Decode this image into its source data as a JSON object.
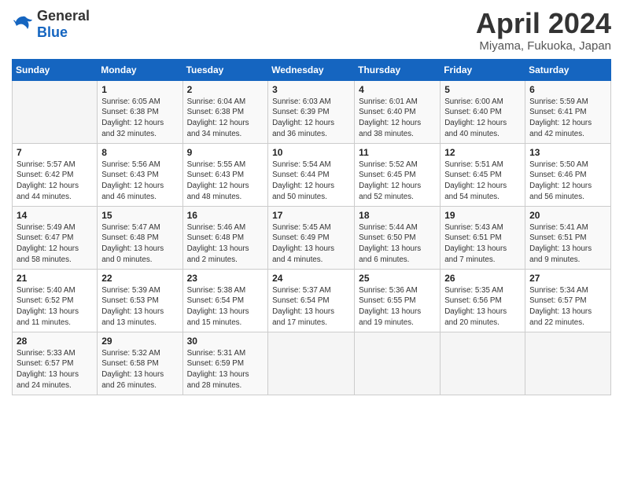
{
  "header": {
    "logo_general": "General",
    "logo_blue": "Blue",
    "title": "April 2024",
    "location": "Miyama, Fukuoka, Japan"
  },
  "calendar": {
    "days_of_week": [
      "Sunday",
      "Monday",
      "Tuesday",
      "Wednesday",
      "Thursday",
      "Friday",
      "Saturday"
    ],
    "weeks": [
      [
        {
          "day": "",
          "info": ""
        },
        {
          "day": "1",
          "info": "Sunrise: 6:05 AM\nSunset: 6:38 PM\nDaylight: 12 hours\nand 32 minutes."
        },
        {
          "day": "2",
          "info": "Sunrise: 6:04 AM\nSunset: 6:38 PM\nDaylight: 12 hours\nand 34 minutes."
        },
        {
          "day": "3",
          "info": "Sunrise: 6:03 AM\nSunset: 6:39 PM\nDaylight: 12 hours\nand 36 minutes."
        },
        {
          "day": "4",
          "info": "Sunrise: 6:01 AM\nSunset: 6:40 PM\nDaylight: 12 hours\nand 38 minutes."
        },
        {
          "day": "5",
          "info": "Sunrise: 6:00 AM\nSunset: 6:40 PM\nDaylight: 12 hours\nand 40 minutes."
        },
        {
          "day": "6",
          "info": "Sunrise: 5:59 AM\nSunset: 6:41 PM\nDaylight: 12 hours\nand 42 minutes."
        }
      ],
      [
        {
          "day": "7",
          "info": "Sunrise: 5:57 AM\nSunset: 6:42 PM\nDaylight: 12 hours\nand 44 minutes."
        },
        {
          "day": "8",
          "info": "Sunrise: 5:56 AM\nSunset: 6:43 PM\nDaylight: 12 hours\nand 46 minutes."
        },
        {
          "day": "9",
          "info": "Sunrise: 5:55 AM\nSunset: 6:43 PM\nDaylight: 12 hours\nand 48 minutes."
        },
        {
          "day": "10",
          "info": "Sunrise: 5:54 AM\nSunset: 6:44 PM\nDaylight: 12 hours\nand 50 minutes."
        },
        {
          "day": "11",
          "info": "Sunrise: 5:52 AM\nSunset: 6:45 PM\nDaylight: 12 hours\nand 52 minutes."
        },
        {
          "day": "12",
          "info": "Sunrise: 5:51 AM\nSunset: 6:45 PM\nDaylight: 12 hours\nand 54 minutes."
        },
        {
          "day": "13",
          "info": "Sunrise: 5:50 AM\nSunset: 6:46 PM\nDaylight: 12 hours\nand 56 minutes."
        }
      ],
      [
        {
          "day": "14",
          "info": "Sunrise: 5:49 AM\nSunset: 6:47 PM\nDaylight: 12 hours\nand 58 minutes."
        },
        {
          "day": "15",
          "info": "Sunrise: 5:47 AM\nSunset: 6:48 PM\nDaylight: 13 hours\nand 0 minutes."
        },
        {
          "day": "16",
          "info": "Sunrise: 5:46 AM\nSunset: 6:48 PM\nDaylight: 13 hours\nand 2 minutes."
        },
        {
          "day": "17",
          "info": "Sunrise: 5:45 AM\nSunset: 6:49 PM\nDaylight: 13 hours\nand 4 minutes."
        },
        {
          "day": "18",
          "info": "Sunrise: 5:44 AM\nSunset: 6:50 PM\nDaylight: 13 hours\nand 6 minutes."
        },
        {
          "day": "19",
          "info": "Sunrise: 5:43 AM\nSunset: 6:51 PM\nDaylight: 13 hours\nand 7 minutes."
        },
        {
          "day": "20",
          "info": "Sunrise: 5:41 AM\nSunset: 6:51 PM\nDaylight: 13 hours\nand 9 minutes."
        }
      ],
      [
        {
          "day": "21",
          "info": "Sunrise: 5:40 AM\nSunset: 6:52 PM\nDaylight: 13 hours\nand 11 minutes."
        },
        {
          "day": "22",
          "info": "Sunrise: 5:39 AM\nSunset: 6:53 PM\nDaylight: 13 hours\nand 13 minutes."
        },
        {
          "day": "23",
          "info": "Sunrise: 5:38 AM\nSunset: 6:54 PM\nDaylight: 13 hours\nand 15 minutes."
        },
        {
          "day": "24",
          "info": "Sunrise: 5:37 AM\nSunset: 6:54 PM\nDaylight: 13 hours\nand 17 minutes."
        },
        {
          "day": "25",
          "info": "Sunrise: 5:36 AM\nSunset: 6:55 PM\nDaylight: 13 hours\nand 19 minutes."
        },
        {
          "day": "26",
          "info": "Sunrise: 5:35 AM\nSunset: 6:56 PM\nDaylight: 13 hours\nand 20 minutes."
        },
        {
          "day": "27",
          "info": "Sunrise: 5:34 AM\nSunset: 6:57 PM\nDaylight: 13 hours\nand 22 minutes."
        }
      ],
      [
        {
          "day": "28",
          "info": "Sunrise: 5:33 AM\nSunset: 6:57 PM\nDaylight: 13 hours\nand 24 minutes."
        },
        {
          "day": "29",
          "info": "Sunrise: 5:32 AM\nSunset: 6:58 PM\nDaylight: 13 hours\nand 26 minutes."
        },
        {
          "day": "30",
          "info": "Sunrise: 5:31 AM\nSunset: 6:59 PM\nDaylight: 13 hours\nand 28 minutes."
        },
        {
          "day": "",
          "info": ""
        },
        {
          "day": "",
          "info": ""
        },
        {
          "day": "",
          "info": ""
        },
        {
          "day": "",
          "info": ""
        }
      ]
    ]
  }
}
